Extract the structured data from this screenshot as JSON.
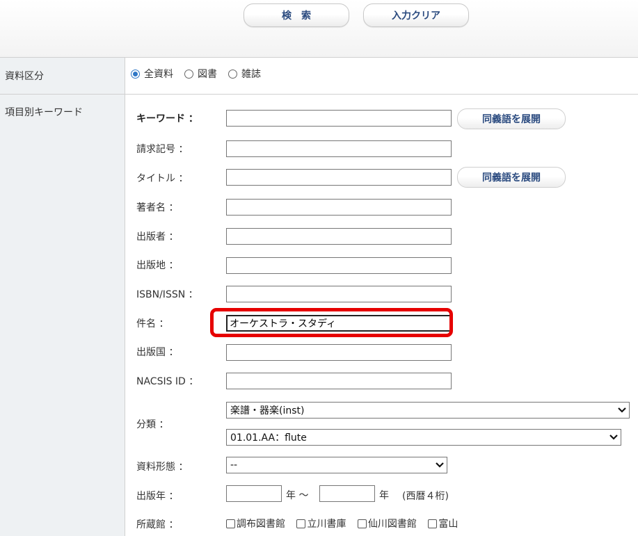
{
  "toolbar": {
    "search_label": "検索",
    "clear_label": "入力クリア"
  },
  "material_type": {
    "label": "資料区分",
    "options": [
      {
        "label": "全資料",
        "selected": true
      },
      {
        "label": "図書",
        "selected": false
      },
      {
        "label": "雑誌",
        "selected": false
      }
    ]
  },
  "keywords_section": {
    "label": "項目別キーワード"
  },
  "fields": {
    "keyword": {
      "label": "キーワード ：",
      "value": ""
    },
    "call_number": {
      "label": "請求記号 ：",
      "value": ""
    },
    "title": {
      "label": "タイトル ：",
      "value": ""
    },
    "author": {
      "label": "著者名 ：",
      "value": ""
    },
    "publisher": {
      "label": "出版者 ：",
      "value": ""
    },
    "place": {
      "label": "出版地 ：",
      "value": ""
    },
    "isbn": {
      "label": "ISBN/ISSN ：",
      "value": ""
    },
    "subject": {
      "label": "件名 ：",
      "value": "オーケストラ・スタディ"
    },
    "country": {
      "label": "出版国 ：",
      "value": ""
    },
    "nacsis": {
      "label": "NACSIS ID ：",
      "value": ""
    }
  },
  "synonym_button_label": "同義語を展開",
  "classification": {
    "label": "分類 ：",
    "primary_selected": "楽譜・器楽(inst)",
    "secondary_selected": "01.01.AA：flute"
  },
  "form_type": {
    "label": "資料形態 ：",
    "selected": "--"
  },
  "pub_year": {
    "label": "出版年 ：",
    "from_suffix": "年 ～",
    "to_suffix": "年",
    "note": "(西暦４桁)"
  },
  "holdings": {
    "label": "所蔵館 ：",
    "libraries": [
      "調布図書館",
      "立川書庫",
      "仙川図書館",
      "富山"
    ]
  },
  "colors": {
    "accent": "#2f77c6",
    "button_text": "#2a4a7f",
    "highlight": "#e60000",
    "left_column": "#eef1f3"
  }
}
